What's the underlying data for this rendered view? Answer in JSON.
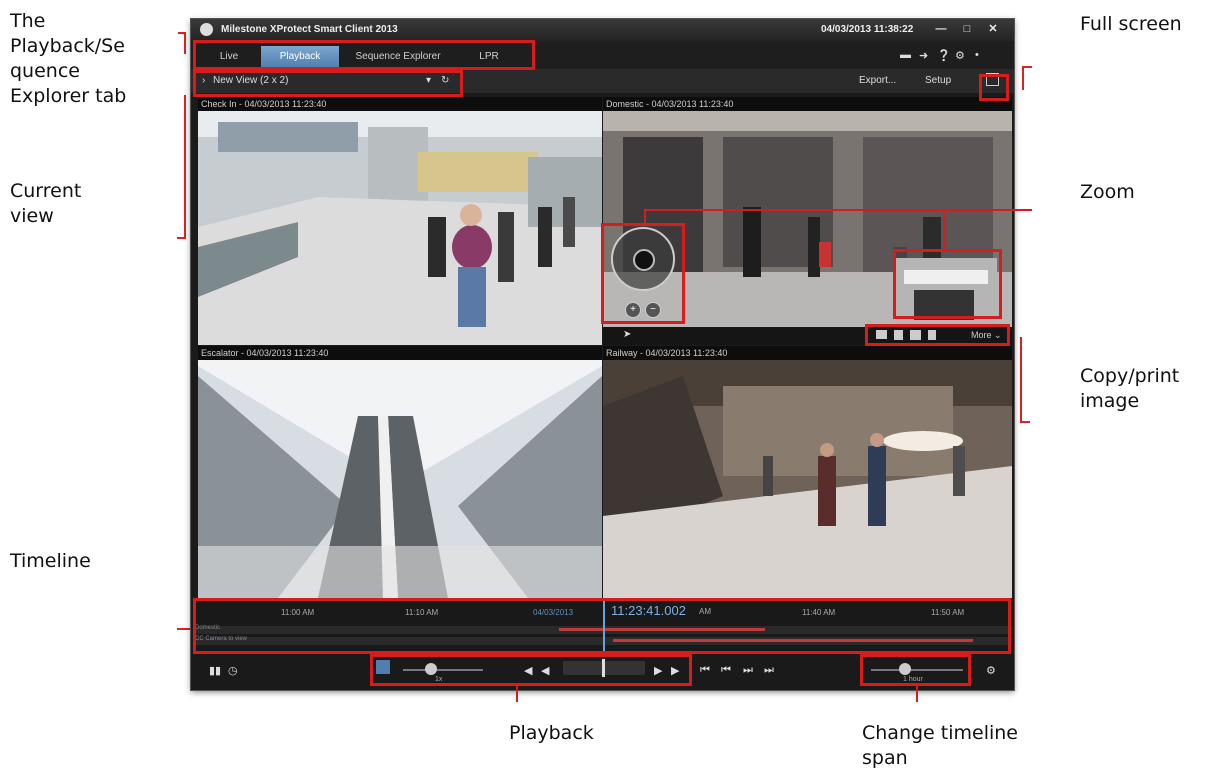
{
  "callouts": {
    "tab": [
      "The",
      "Playback/Se",
      "quence",
      "Explorer tab"
    ],
    "current_view": [
      "Current",
      "view"
    ],
    "timeline": "Timeline",
    "full_screen": "Full screen",
    "zoom": "Zoom",
    "copy_print": [
      "Copy/print",
      "image"
    ],
    "playback": "Playback",
    "timeline_span": [
      "Change timeline",
      "span"
    ]
  },
  "app": {
    "title": "Milestone XProtect Smart Client 2013",
    "datetime": "04/03/2013 11:38:22",
    "tabs": [
      "Live",
      "Playback",
      "Sequence Explorer",
      "LPR"
    ],
    "view_name": "New View (2 x 2)",
    "export_label": "Export...",
    "setup_label": "Setup",
    "cameras": [
      "Check In - 04/03/2013 11:23:40",
      "Domestic - 04/03/2013 11:23:40",
      "Escalator - 04/03/2013 11:23:40",
      "Railway - 04/03/2013 11:23:40"
    ],
    "more_label": "More",
    "timeline": {
      "ticks": [
        "11:00 AM",
        "11:10 AM",
        "04/03/2013",
        "11:40 AM",
        "11:50 AM"
      ],
      "current_time": "11:23:41.002",
      "current_ampm": "AM",
      "row1": "Domestic",
      "row2": "CC Camera to view"
    },
    "speed": "1x",
    "span": "1 hour"
  }
}
